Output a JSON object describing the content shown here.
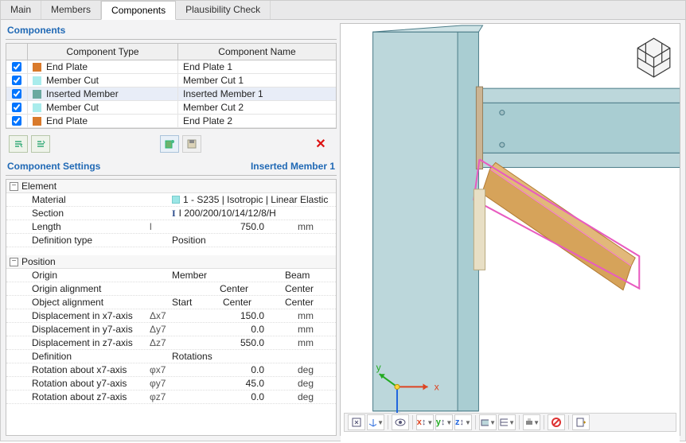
{
  "tabs": {
    "main": "Main",
    "members": "Members",
    "components": "Components",
    "plausibility": "Plausibility Check",
    "active": "components"
  },
  "components_panel": {
    "title": "Components",
    "columns": {
      "type": "Component Type",
      "name": "Component Name"
    },
    "rows": [
      {
        "checked": true,
        "color": "#d97a2b",
        "type": "End Plate",
        "name": "End Plate 1",
        "selected": false
      },
      {
        "checked": true,
        "color": "#a9ecec",
        "type": "Member Cut",
        "name": "Member Cut 1",
        "selected": false
      },
      {
        "checked": true,
        "color": "#6aa9a1",
        "type": "Inserted Member",
        "name": "Inserted Member 1",
        "selected": true
      },
      {
        "checked": true,
        "color": "#a9ecec",
        "type": "Member Cut",
        "name": "Member Cut 2",
        "selected": false
      },
      {
        "checked": true,
        "color": "#d97a2b",
        "type": "End Plate",
        "name": "End Plate 2",
        "selected": false
      }
    ]
  },
  "settings_panel": {
    "title": "Component Settings",
    "subject": "Inserted Member 1",
    "element": {
      "title": "Element",
      "material": {
        "label": "Material",
        "value": "1 - S235 | Isotropic | Linear Elastic"
      },
      "section": {
        "label": "Section",
        "value": "I 200/200/10/14/12/8/H"
      },
      "length": {
        "label": "Length",
        "symbol": "l",
        "value": "750.0",
        "unit": "mm"
      },
      "deftype": {
        "label": "Definition type",
        "value": "Position"
      }
    },
    "position": {
      "title": "Position",
      "head": {
        "origin": "Origin",
        "col_member": "Member",
        "col_beam": "Beam"
      },
      "origin_alignment": {
        "label": "Origin alignment",
        "member": "Center",
        "beam": "Center"
      },
      "object_alignment": {
        "label": "Object alignment",
        "ref": "Start",
        "member": "Center",
        "beam": "Center"
      },
      "disp_x": {
        "label": "Displacement in x7-axis",
        "symbol": "Δx7",
        "value": "150.0",
        "unit": "mm"
      },
      "disp_y": {
        "label": "Displacement in y7-axis",
        "symbol": "Δy7",
        "value": "0.0",
        "unit": "mm"
      },
      "disp_z": {
        "label": "Displacement in z7-axis",
        "symbol": "Δz7",
        "value": "550.0",
        "unit": "mm"
      },
      "definition": {
        "label": "Definition",
        "value": "Rotations"
      },
      "rot_x": {
        "label": "Rotation about x7-axis",
        "symbol": "φx7",
        "value": "0.0",
        "unit": "deg"
      },
      "rot_y": {
        "label": "Rotation about y7-axis",
        "symbol": "φy7",
        "value": "45.0",
        "unit": "deg"
      },
      "rot_z": {
        "label": "Rotation about z7-axis",
        "symbol": "φz7",
        "value": "0.0",
        "unit": "deg"
      }
    }
  },
  "viewport": {
    "axes": {
      "x": "x",
      "y": "y",
      "z": "z"
    }
  }
}
